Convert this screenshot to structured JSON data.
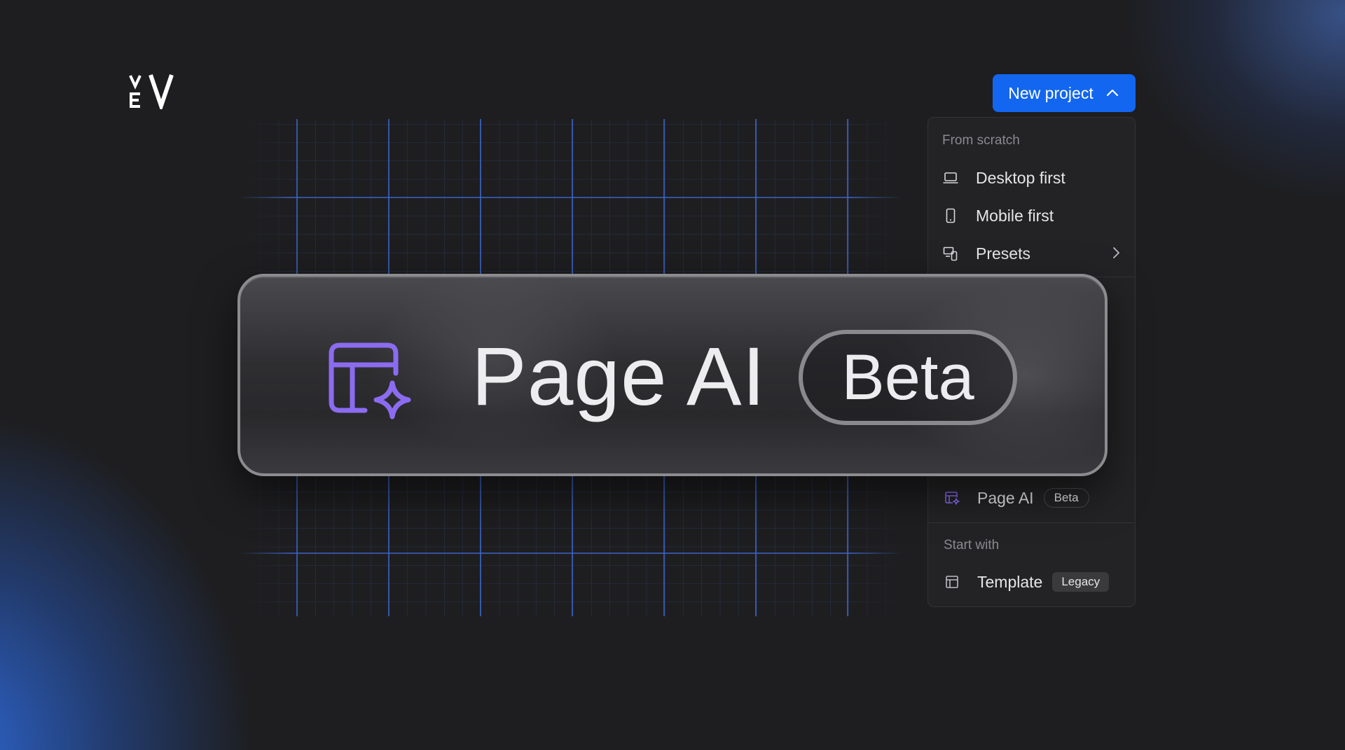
{
  "toolbar": {
    "new_project_label": "New project"
  },
  "menu": {
    "section_scratch": "From scratch",
    "items_scratch": [
      {
        "label": "Desktop first",
        "icon": "laptop-icon"
      },
      {
        "label": "Mobile first",
        "icon": "mobile-icon"
      },
      {
        "label": "Presets",
        "icon": "presets-icon",
        "has_submenu": true
      }
    ],
    "page_ai": {
      "label": "Page AI",
      "badge": "Beta",
      "icon": "page-ai-icon"
    },
    "section_start": "Start with",
    "template": {
      "label": "Template",
      "badge": "Legacy",
      "icon": "template-icon"
    }
  },
  "banner": {
    "title": "Page AI",
    "badge": "Beta",
    "icon": "page-ai-icon"
  },
  "colors": {
    "accent": "#1266f0",
    "ai_purple": "#8b6cf0",
    "background": "#1e1e20"
  }
}
